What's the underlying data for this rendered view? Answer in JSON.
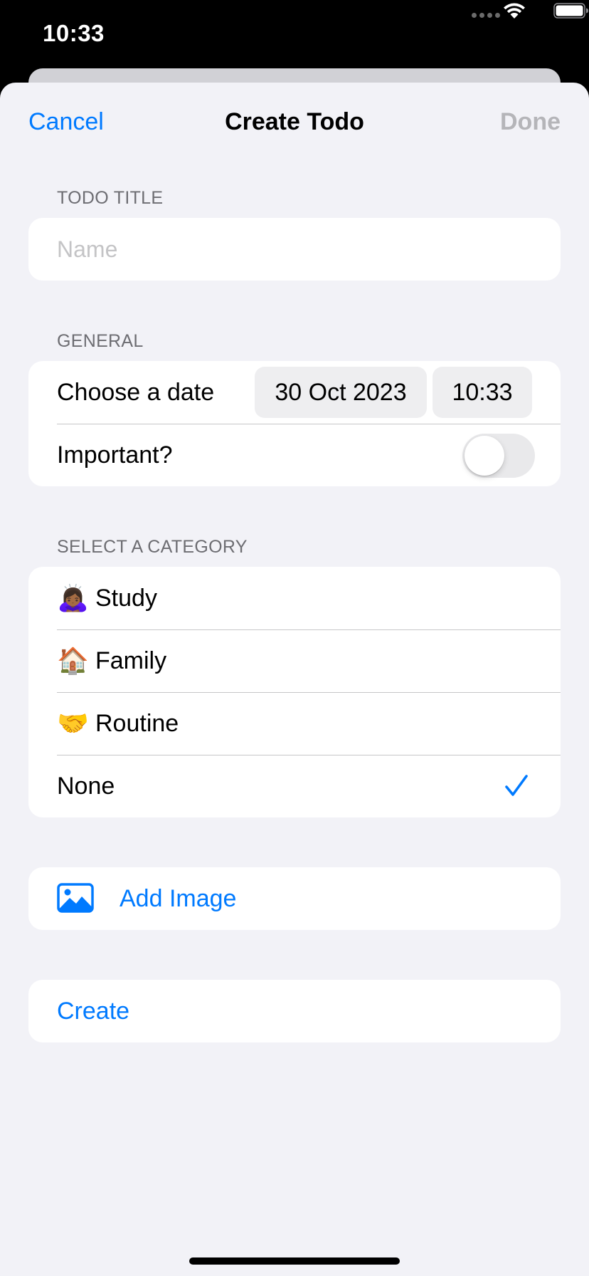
{
  "status_bar": {
    "time": "10:33"
  },
  "nav": {
    "cancel_label": "Cancel",
    "title": "Create Todo",
    "done_label": "Done"
  },
  "todo_title_section": {
    "header": "TODO TITLE",
    "name_placeholder": "Name",
    "name_value": ""
  },
  "general_section": {
    "header": "GENERAL",
    "date_label": "Choose a date",
    "date_value": "30 Oct 2023",
    "time_value": "10:33",
    "important_label": "Important?",
    "important_on": false
  },
  "category_section": {
    "header": "SELECT A CATEGORY",
    "items": [
      {
        "emoji": "🙇🏾‍♀️",
        "label": "Study",
        "selected": false
      },
      {
        "emoji": "🏠",
        "label": "Family",
        "selected": false
      },
      {
        "emoji": "🤝",
        "label": "Routine",
        "selected": false
      },
      {
        "emoji": "",
        "label": "None",
        "selected": true
      }
    ]
  },
  "image_section": {
    "icon": "photo-icon",
    "label": "Add Image"
  },
  "create_section": {
    "label": "Create"
  },
  "colors": {
    "accent": "#007aff",
    "background": "#f2f2f7",
    "disabled": "#b5b5b9"
  }
}
